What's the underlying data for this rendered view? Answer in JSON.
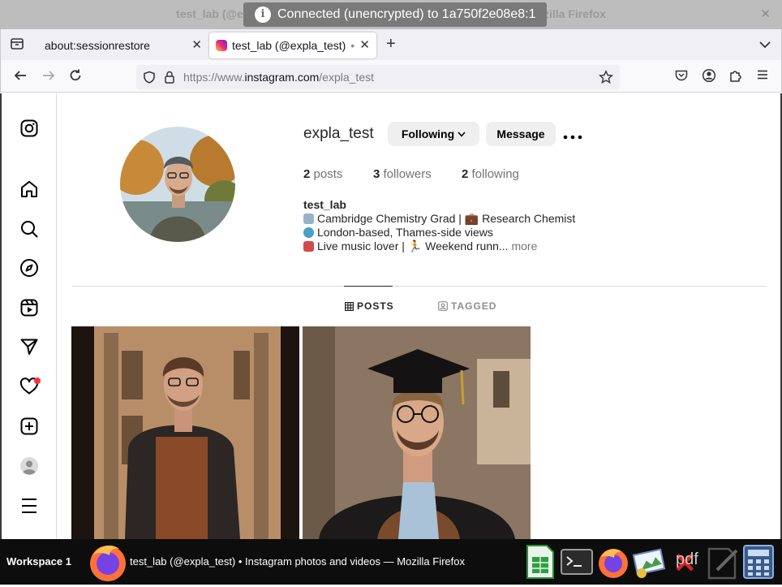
{
  "window": {
    "title": "test_lab (@expla_test) • Instagram photos and videos — Mozilla Firefox",
    "title_fragment_left": "test_lab (@e",
    "title_fragment_right": "zilla Firefox",
    "close_glyph": "✕",
    "banner_text": "Connected (unencrypted) to 1a750f2e08e8:1",
    "banner_icon": "info-icon"
  },
  "browser": {
    "tabs": [
      {
        "label": "about:sessionrestore",
        "active": false
      },
      {
        "label": "test_lab (@expla_test)",
        "active": true
      }
    ],
    "active_tab_dot": "•",
    "tab_close_glyph": "✕",
    "new_tab_glyph": "+",
    "url_prefix": "https://www.",
    "url_domain": "instagram.com",
    "url_path": "/expla_test"
  },
  "profile": {
    "username": "expla_test",
    "following_button": "Following",
    "message_button": "Message",
    "stats": {
      "posts_count": "2",
      "posts_label": "posts",
      "followers_count": "3",
      "followers_label": "followers",
      "following_count": "2",
      "following_label": "following"
    },
    "display_name": "test_lab",
    "bio": [
      "Cambridge Chemistry Grad | 💼 Research Chemist",
      "London-based, Thames-side views",
      "Live music lover | 🏃 Weekend runn..."
    ],
    "bio_more": "more",
    "tabs": {
      "posts": "POSTS",
      "tagged": "TAGGED"
    }
  },
  "colors": {
    "notification_dot": "#ff3040",
    "taskbar": "#0d0d0d",
    "firefox_orange": "#ff7139",
    "firefox_purple": "#7542e5"
  },
  "taskbar": {
    "workspace": "Workspace 1",
    "window_title": "test_lab (@expla_test) • Instagram photos and videos — Mozilla Firefox",
    "pdf_label": "pdf"
  }
}
